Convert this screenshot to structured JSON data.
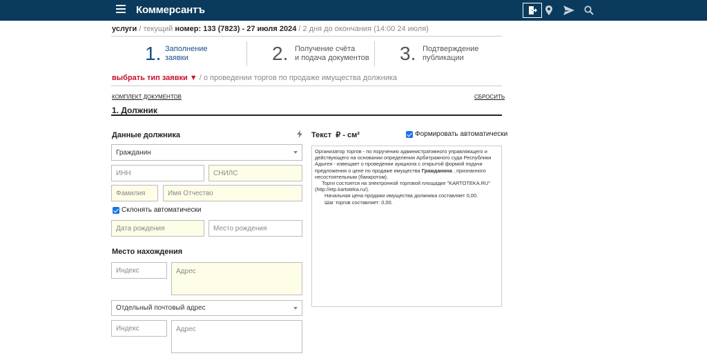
{
  "header": {
    "logo": "Коммерсантъ",
    "icons": [
      "menu-icon",
      "exit-icon",
      "location-pin-icon",
      "send-icon",
      "search-icon"
    ]
  },
  "breadcrumb": {
    "section": "услуги",
    "current": "/ текущий",
    "issue": "номер: 133 (7823) - 27 июля 2024",
    "remaining": "/ 2 дня до окончания (14:00 24 июля)"
  },
  "steps": [
    {
      "num": "1.",
      "line1": "Заполнение",
      "line2": "заявки",
      "active": true
    },
    {
      "num": "2.",
      "line1": "Получение счёта",
      "line2": "и подача документов",
      "active": false
    },
    {
      "num": "3.",
      "line1": "Подтверждение",
      "line2": "публикации",
      "active": false
    }
  ],
  "type_select": {
    "label": "выбрать тип заявки ▼",
    "description": "/ о проведении торгов по продаже имущества должника"
  },
  "links": {
    "documents": "КОМПЛЕКТ ДОКУМЕНТОВ",
    "reset": "СБРОСИТЬ"
  },
  "section_title": "1. Должник",
  "debtor": {
    "title": "Данные должника",
    "type_value": "Гражданин",
    "inn_placeholder": "ИНН",
    "snils_placeholder": "СНИЛС",
    "surname_placeholder": "Фамилия",
    "name_placeholder": "Имя Отчество",
    "decline_label": "Склонять автоматически",
    "birthdate_placeholder": "Дата рождения",
    "birthplace_placeholder": "Место рождения"
  },
  "location": {
    "title": "Место нахождения",
    "index_placeholder": "Индекс",
    "address_placeholder": "Адрес",
    "postal_select": "Отдельный почтовый адрес",
    "index2_placeholder": "Индекс",
    "address2_placeholder": "Адрес"
  },
  "text_panel": {
    "title": "Текст",
    "currency": "₽ - см²",
    "auto_label": "Формировать автоматически",
    "p1": "Организатор торгов - по поручению административного управляющего и действующего на основании определения Арбитражного суда Республики Адыгея - извещает о проведении аукциона с открытой формой подачи предложения о цене по продаже имущества",
    "p1_bold": "Гражданина",
    "p1_tail": ", признанного несостоятельным (банкротом).",
    "p2": "Торги состоятся на электронной торговой площадке \"KARTOTEKA.RU\" (http://etp.kartoteka.ru/).",
    "p3": "Начальная цена продажи имущества должника составляет 0,00.",
    "p4": "Шаг торгов составляет: 0,00."
  }
}
